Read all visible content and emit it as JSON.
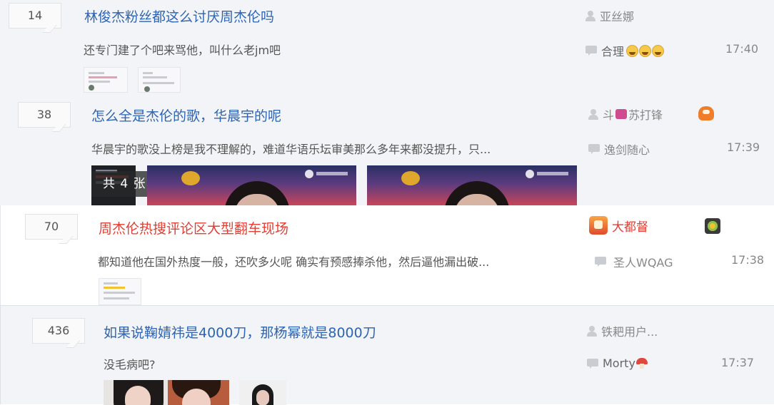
{
  "threads": [
    {
      "reply_count": "14",
      "title": "林俊杰粉丝都这么讨厌周杰伦吗",
      "abstract": "还专门建了个吧来骂他，叫什么老jm吧",
      "author": "亚丝娜",
      "last_reply_user": "合理",
      "last_reply_time": "17:40"
    },
    {
      "reply_count": "38",
      "title": "怎么全是杰伦的歌，华晨宇的呢",
      "abstract": "华晨宇的歌没上榜是我不理解的，难道华语乐坛审美那么多年来都没提升，只...",
      "author_prefix": "斗",
      "author_suffix": "苏打锋",
      "last_reply_user": "逸剑随心",
      "last_reply_time": "17:39",
      "album_badge": "共 4 张"
    },
    {
      "reply_count": "70",
      "title": "周杰伦热搜评论区大型翻车现场",
      "abstract": "都知道他在国外热度一般，还吹多火呢 确实有预感捧杀他，然后逼他漏出破...",
      "author": "大都督",
      "last_reply_user": "圣人WQAG",
      "last_reply_time": "17:38"
    },
    {
      "reply_count": "436",
      "title": "如果说鞠婧祎是4000刀，那杨幂就是8000刀",
      "abstract": "没毛病吧?",
      "author": "铁耙用户...",
      "last_reply_user": "Morty",
      "last_reply_time": "17:37"
    }
  ],
  "colors": {
    "title_blue": "#2d64b3",
    "title_red": "#e33e33",
    "meta_gray": "#888888"
  }
}
